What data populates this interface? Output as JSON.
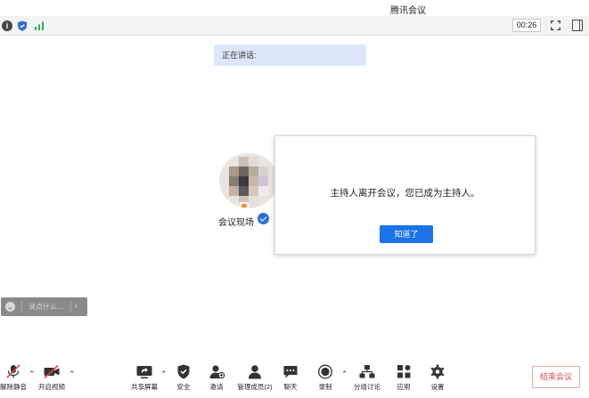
{
  "app": {
    "title": "腾讯会议"
  },
  "statusbar": {
    "timer": "00:26"
  },
  "speaking": {
    "label": "正在讲话:"
  },
  "participant": {
    "name": "会议现场"
  },
  "dialog": {
    "message": "主持人离开会议，您已成为主持人。",
    "ok_label": "知道了"
  },
  "chat": {
    "placeholder": "说点什么..."
  },
  "toolbar": {
    "unmute": "解除静音",
    "start_video": "开启视频",
    "share_screen": "共享屏幕",
    "security": "安全",
    "invite": "邀请",
    "manage_members": "管理成员(2)",
    "chat": "聊天",
    "record": "录制",
    "breakout": "分组讨论",
    "apps": "应用",
    "settings": "设置",
    "end_meeting": "结束会议"
  },
  "colors": {
    "accent": "#1a73e8",
    "danger": "#e04848",
    "speaking_bg": "#dbe7f8"
  }
}
